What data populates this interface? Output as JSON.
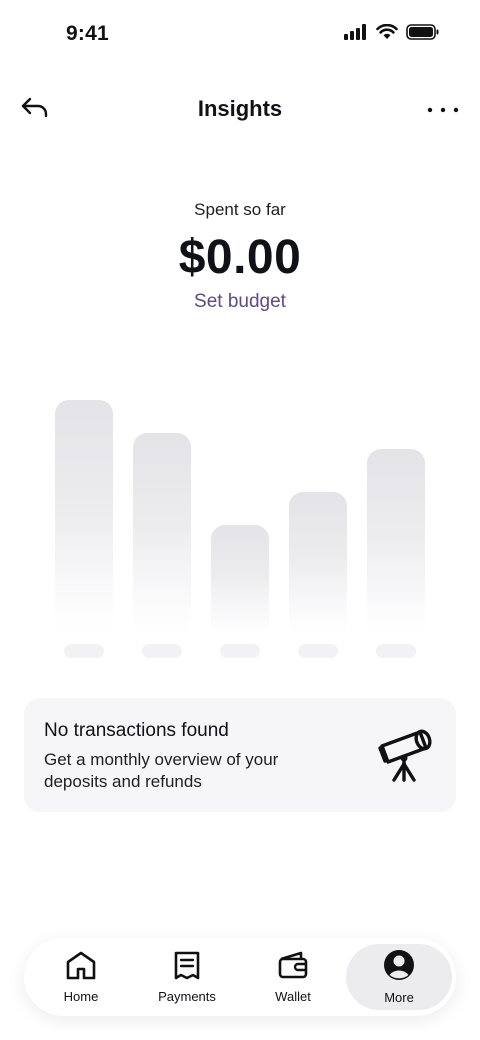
{
  "status_bar": {
    "time": "9:41",
    "icons": [
      "signal-icon",
      "wifi-icon",
      "battery-icon"
    ]
  },
  "header": {
    "title": "Insights",
    "back_icon": "back-arrow-icon",
    "more_icon": "more-dots-icon"
  },
  "summary": {
    "spent_label": "Spent so far",
    "amount": "$0.00",
    "budget_link": "Set budget",
    "link_color": "#5a4a8c"
  },
  "chart_data": {
    "type": "bar",
    "categories": [
      "",
      "",
      "",
      "",
      ""
    ],
    "values": [
      1.0,
      0.86,
      0.47,
      0.61,
      0.79
    ],
    "placeholder": true
  },
  "empty_state": {
    "title": "No transactions found",
    "description": "Get a monthly overview of your deposits and refunds",
    "icon": "telescope-icon"
  },
  "bottom_nav": {
    "items": [
      {
        "label": "Home",
        "icon": "home-icon",
        "active": false
      },
      {
        "label": "Payments",
        "icon": "receipt-icon",
        "active": false
      },
      {
        "label": "Wallet",
        "icon": "wallet-icon",
        "active": false
      },
      {
        "label": "More",
        "icon": "profile-icon",
        "active": true
      }
    ]
  }
}
